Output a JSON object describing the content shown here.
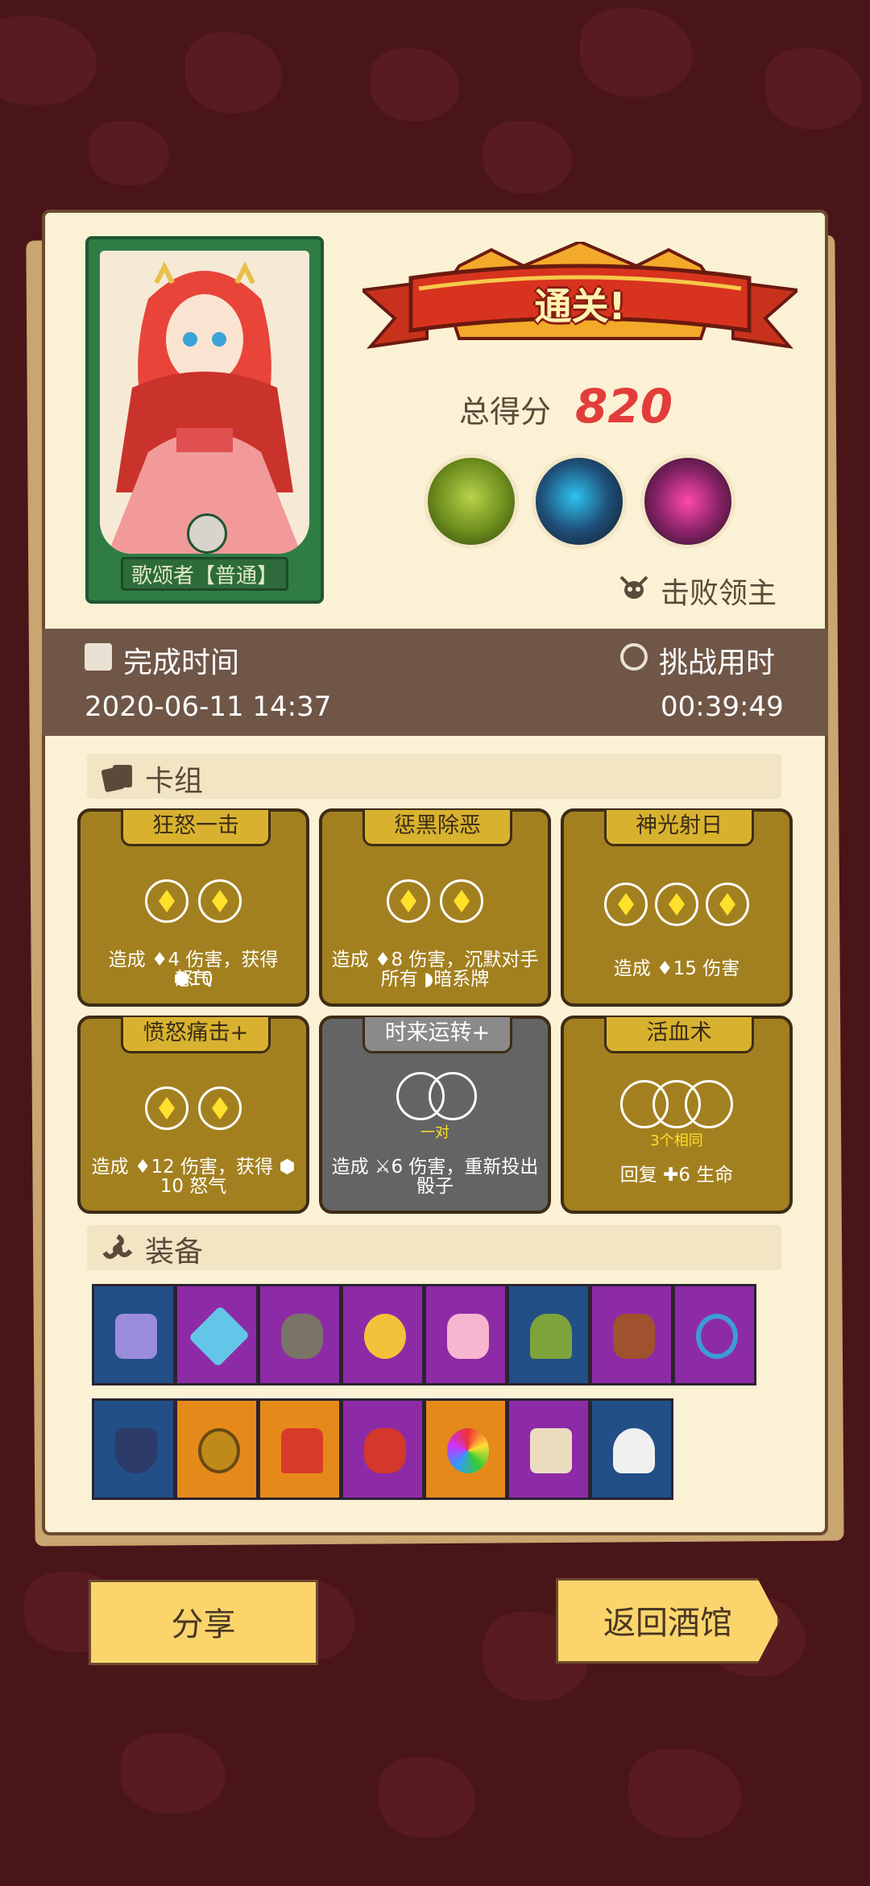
{
  "hero": {
    "name": "歌颂者【普通】"
  },
  "result": {
    "banner": "通关!",
    "score_label": "总得分",
    "score": "820",
    "boss_label": "击败领主"
  },
  "time": {
    "finish_label": "完成时间",
    "finish_value": "2020-06-11 14:37",
    "duration_label": "挑战用时",
    "duration_value": "00:39:49"
  },
  "deck": {
    "title": "卡组",
    "cards": [
      {
        "name": "狂怒一击",
        "style": "gold",
        "slots": 2,
        "desc1": "造成 ♦4 伤害，获得 ⬢10",
        "desc2": "怒气"
      },
      {
        "name": "惩黑除恶",
        "style": "gold",
        "slots": 2,
        "desc1": "造成 ♦8 伤害，沉默对手",
        "desc2": "所有 ◗暗系牌"
      },
      {
        "name": "神光射日",
        "style": "gold",
        "slots": 3,
        "desc1": "造成 ♦15 伤害",
        "desc2": ""
      },
      {
        "name": "愤怒痛击+",
        "style": "gold",
        "slots": 2,
        "desc1": "造成 ♦12 伤害，获得 ⬢",
        "desc2": "10 怒气"
      },
      {
        "name": "时来运转+",
        "style": "gray",
        "slots": 2,
        "sub": "一对",
        "desc1": "造成 ⚔6 伤害，重新投出",
        "desc2": "骰子"
      },
      {
        "name": "活血术",
        "style": "gold",
        "slots": 3,
        "sub": "3个相同",
        "desc1": "回复 ✚6 生命",
        "desc2": ""
      }
    ]
  },
  "equipment": {
    "title": "装备",
    "row1": [
      {
        "icon": "wizard-boot-icon",
        "bg": "blue"
      },
      {
        "icon": "blue-gem-icon",
        "bg": "purple"
      },
      {
        "icon": "stone-icon",
        "bg": "purple"
      },
      {
        "icon": "golden-trophy-icon",
        "bg": "purple"
      },
      {
        "icon": "pink-crystal-icon",
        "bg": "purple"
      },
      {
        "icon": "voodoo-doll-icon",
        "bg": "blue"
      },
      {
        "icon": "fire-rock-icon",
        "bg": "purple"
      },
      {
        "icon": "heart-charm-icon",
        "bg": "purple"
      }
    ],
    "row2": [
      {
        "icon": "top-hat-icon",
        "bg": "blue"
      },
      {
        "icon": "gold-medallion-icon",
        "bg": "orange"
      },
      {
        "icon": "red-skirt-icon",
        "bg": "orange"
      },
      {
        "icon": "spiked-bracer-icon",
        "bg": "purple"
      },
      {
        "icon": "rainbow-orb-icon",
        "bg": "orange"
      },
      {
        "icon": "scroll-icon",
        "bg": "purple"
      },
      {
        "icon": "skull-dagger-icon",
        "bg": "blue"
      }
    ]
  },
  "buttons": {
    "share": "分享",
    "back": "返回酒馆"
  },
  "colors": {
    "background": "#4a1519",
    "panel": "#fbf1d4",
    "score": "#e23d3a"
  }
}
